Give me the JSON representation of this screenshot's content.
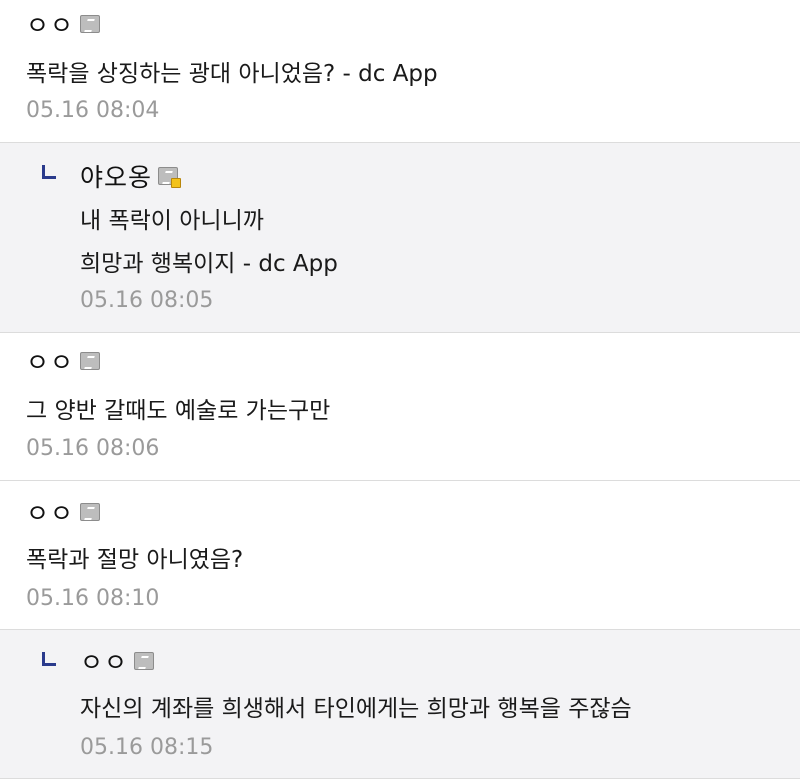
{
  "comments": [
    {
      "nick": "ㅇㅇ",
      "text_lines": [
        "폭락을 상징하는 광대 아니었음? - dc App"
      ],
      "time": "05.16 08:04",
      "reply": false
    },
    {
      "nick": "야오옹",
      "text_lines": [
        "내 폭락이 아니니까",
        "희망과 행복이지 - dc App"
      ],
      "time": "05.16 08:05",
      "reply": true,
      "gold_badge": true
    },
    {
      "nick": "ㅇㅇ",
      "text_lines": [
        "그 양반 갈때도 예술로 가는구만"
      ],
      "time": "05.16 08:06",
      "reply": false
    },
    {
      "nick": "ㅇㅇ",
      "text_lines": [
        "폭락과 절망 아니였음?"
      ],
      "time": "05.16 08:10",
      "reply": false
    },
    {
      "nick": "ㅇㅇ",
      "text_lines": [
        "자신의 계좌를 희생해서 타인에게는 희망과 행복을 주잖슴"
      ],
      "time": "05.16 08:15",
      "reply": true
    }
  ],
  "icons": {
    "user_badge": "gallery-user-badge-icon",
    "reply_marker": "reply-arrow-icon"
  },
  "colors": {
    "reply_background": "#f3f3f5",
    "reply_marker": "#2a3a8c",
    "timestamp": "#9a9a9a"
  }
}
